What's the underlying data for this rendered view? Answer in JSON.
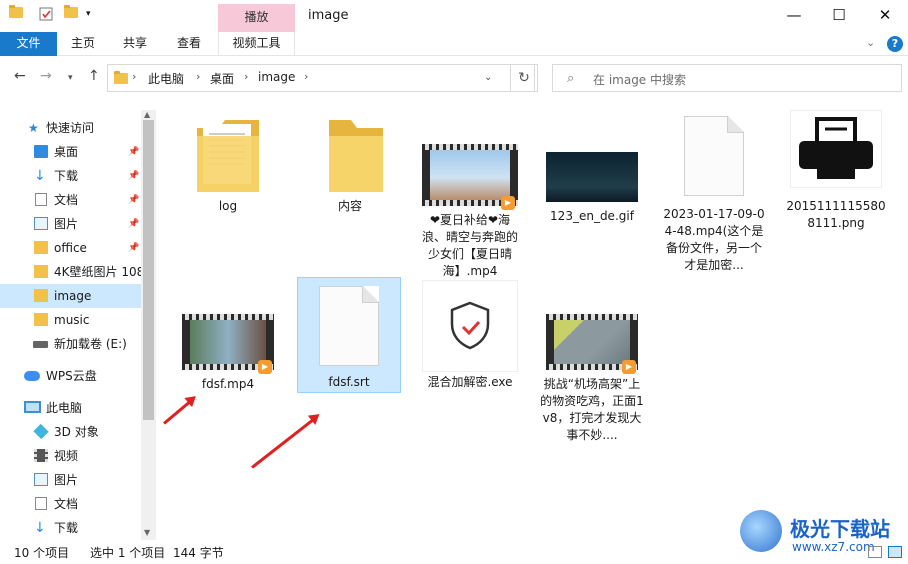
{
  "window": {
    "title": "image",
    "context_tab": "播放",
    "minimize": "—",
    "maximize": "☐",
    "close": "✕"
  },
  "ribbon": {
    "tabs": [
      "文件",
      "主页",
      "共享",
      "查看",
      "视频工具"
    ],
    "help": "?"
  },
  "address": {
    "crumbs": [
      "此电脑",
      "桌面",
      "image"
    ],
    "search_placeholder": "在 image 中搜索"
  },
  "sidebar": {
    "items": [
      {
        "label": "快速访问",
        "icon": "star-icon"
      },
      {
        "label": "桌面",
        "icon": "desktop-icon"
      },
      {
        "label": "下载",
        "icon": "download-icon"
      },
      {
        "label": "文档",
        "icon": "document-icon"
      },
      {
        "label": "图片",
        "icon": "picture-icon"
      },
      {
        "label": "office",
        "icon": "folder-icon"
      },
      {
        "label": "4K壁纸图片 108",
        "icon": "folder-icon"
      },
      {
        "label": "image",
        "icon": "folder-icon"
      },
      {
        "label": "music",
        "icon": "folder-icon"
      },
      {
        "label": "新加载卷 (E:)",
        "icon": "drive-icon"
      },
      {
        "label": "WPS云盘",
        "icon": "cloud-icon"
      },
      {
        "label": "此电脑",
        "icon": "computer-icon"
      },
      {
        "label": "3D 对象",
        "icon": "cube-icon"
      },
      {
        "label": "视频",
        "icon": "video-icon"
      },
      {
        "label": "图片",
        "icon": "picture-icon"
      },
      {
        "label": "文档",
        "icon": "document-icon"
      },
      {
        "label": "下载",
        "icon": "download-icon"
      }
    ]
  },
  "files": [
    {
      "name": "log",
      "type": "folder"
    },
    {
      "name": "内容",
      "type": "folder"
    },
    {
      "name": "❤夏日补给❤海浪、晴空与奔跑的少女们【夏日晴海】.mp4",
      "type": "video"
    },
    {
      "name": "123_en_de.gif",
      "type": "gif"
    },
    {
      "name": "2023-01-17-09-04-48.mp4(这个是备份文件，另一个才是加密...",
      "type": "doc"
    },
    {
      "name": "20151111155808111.png",
      "type": "printer"
    },
    {
      "name": "fdsf.mp4",
      "type": "video"
    },
    {
      "name": "fdsf.srt",
      "type": "doc"
    },
    {
      "name": "混合加解密.exe",
      "type": "exe"
    },
    {
      "name": "挑战“机场高架”上的物资吃鸡，正面1v8，打完才发现大事不妙....",
      "type": "video"
    }
  ],
  "status": {
    "count": "10 个项目",
    "selection": "选中 1 个项目",
    "size": "144 字节"
  },
  "watermark": {
    "name": "极光下载站",
    "url": "www.xz7.com"
  },
  "colors": {
    "accent": "#1979ca",
    "selection": "#cce8ff",
    "context_tab": "#f6c8d8",
    "arrow": "#e02020"
  }
}
